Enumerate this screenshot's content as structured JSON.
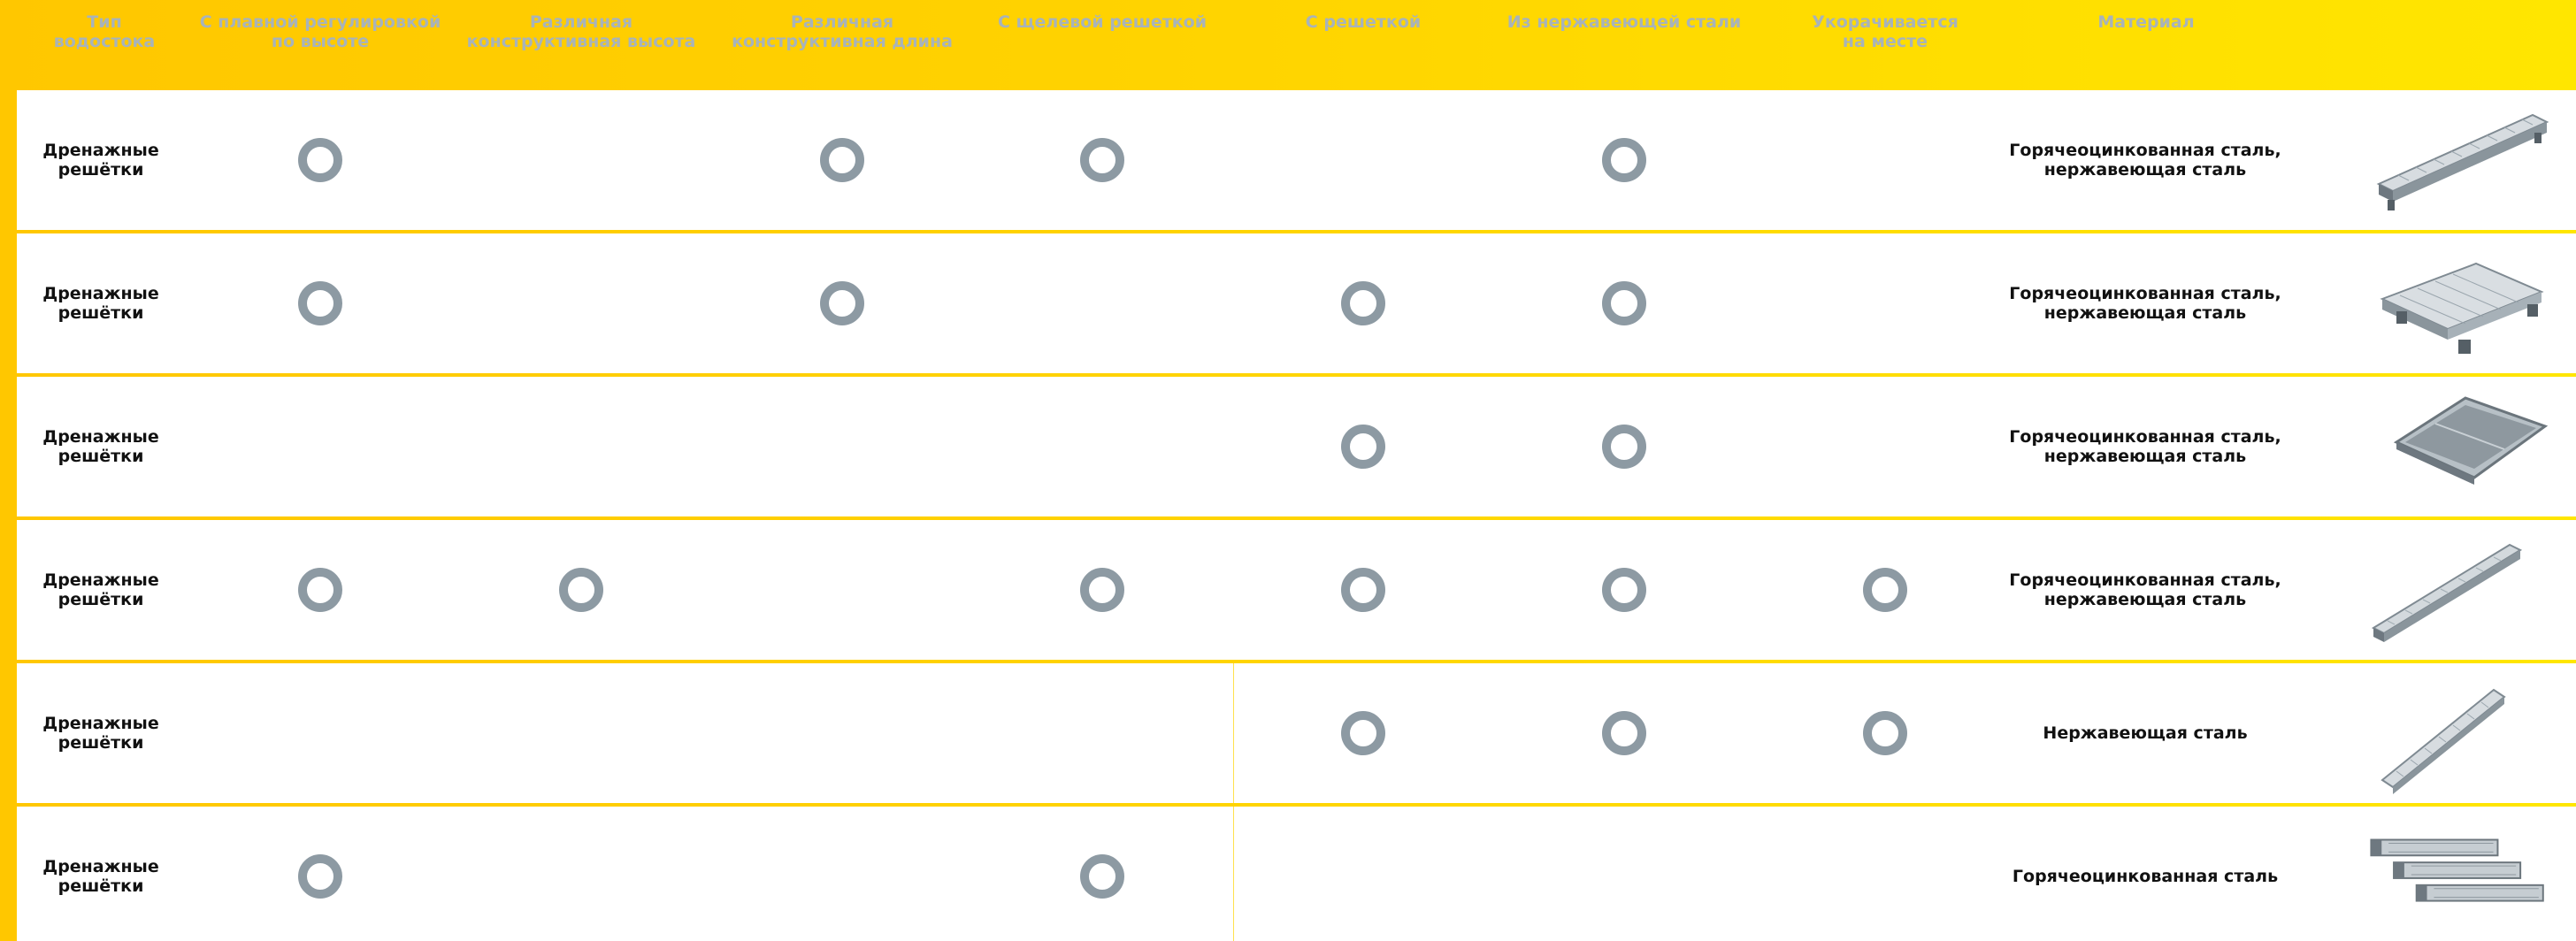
{
  "header": {
    "columns": [
      "Тип\nводостока",
      "С плавной регулировкой\nпо высоте",
      "Различная\nконструктивная высота",
      "Различная\nконструктивная длина",
      "С щелевой решеткой",
      "С решеткой",
      "Из нержавеющей стали",
      "Укорачивается\nна месте",
      "Материал"
    ]
  },
  "rows": [
    {
      "title": "Дренажные\nрешётки",
      "material": "Горячеоцинкованная сталь,\nнержавеющая сталь",
      "features": [
        true,
        false,
        true,
        true,
        false,
        true,
        false
      ],
      "image_icon": "linear-drain-grate-icon"
    },
    {
      "title": "Дренажные\nрешётки",
      "material": "Горячеоцинкованная сталь,\nнержавеющая сталь",
      "features": [
        true,
        false,
        true,
        false,
        true,
        true,
        false
      ],
      "image_icon": "square-drain-grate-icon"
    },
    {
      "title": "Дренажные\nрешётки",
      "material": "Горячеоцинкованная сталь,\nнержавеющая сталь",
      "features": [
        false,
        false,
        false,
        false,
        true,
        true,
        false
      ],
      "image_icon": "tray-drain-icon"
    },
    {
      "title": "Дренажные\nрешётки",
      "material": "Горячеоцинкованная сталь,\nнержавеющая сталь",
      "features": [
        true,
        true,
        false,
        true,
        true,
        true,
        true
      ],
      "image_icon": "long-slot-drain-icon"
    },
    {
      "title": "Дренажные\nрешётки",
      "material": "Нержавеющая сталь",
      "features": [
        false,
        false,
        false,
        false,
        true,
        true,
        true
      ],
      "image_icon": "diagonal-drain-grate-icon"
    },
    {
      "title": "Дренажные\nрешётки",
      "material": "Горячеоцинкованная сталь",
      "features": [
        true,
        false,
        false,
        true,
        false,
        false,
        false
      ],
      "image_icon": "stacked-drain-sections-icon"
    }
  ],
  "colors": {
    "header_gradient_start": "#FFC700",
    "header_gradient_end": "#FFE600",
    "header_text": "#a8b3ba",
    "dot": "#8d9aa3",
    "separator": "#FFD700"
  }
}
